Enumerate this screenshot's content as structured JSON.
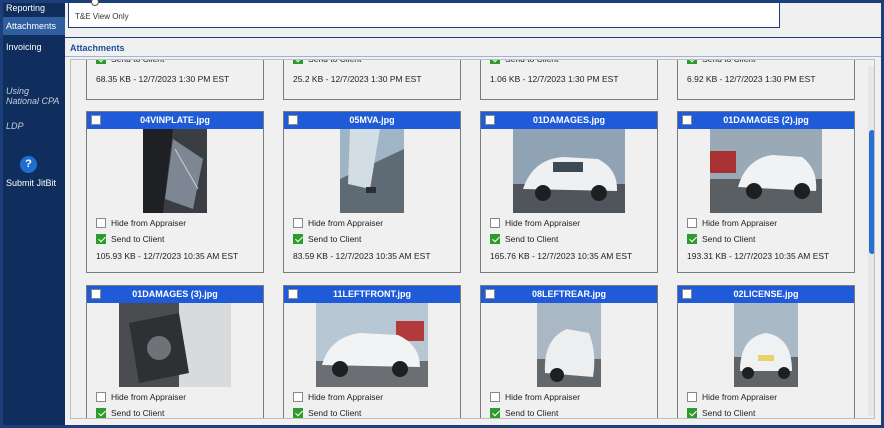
{
  "sidebar": {
    "items": [
      {
        "label": "Reporting"
      },
      {
        "label": "Attachments"
      },
      {
        "label": "Invoicing"
      },
      {
        "label": "Using National CPA"
      },
      {
        "label": "LDP"
      },
      {
        "label": "Submit JitBit"
      }
    ]
  },
  "top": {
    "note": "T&E View Only"
  },
  "section": {
    "title": "Attachments"
  },
  "options": {
    "hide": "Hide from Appraiser",
    "send": "Send to Client"
  },
  "partial_row": [
    {
      "meta": "68.35 KB - 12/7/2023 1:30 PM EST",
      "send_checked": true
    },
    {
      "meta": "25.2 KB - 12/7/2023 1:30 PM EST",
      "send_checked": true
    },
    {
      "meta": "1.06 KB - 12/7/2023 1:30 PM EST",
      "send_checked": true
    },
    {
      "meta": "6.92 KB - 12/7/2023 1:30 PM EST",
      "send_checked": true
    }
  ],
  "cards": [
    {
      "file": "04VINPLATE.jpg",
      "meta": "105.93 KB - 12/7/2023 10:35 AM EST",
      "hide_checked": false,
      "send_checked": true
    },
    {
      "file": "05MVA.jpg",
      "meta": "83.59 KB - 12/7/2023 10:35 AM EST",
      "hide_checked": false,
      "send_checked": true
    },
    {
      "file": "01DAMAGES.jpg",
      "meta": "165.76 KB - 12/7/2023 10:35 AM EST",
      "hide_checked": false,
      "send_checked": true
    },
    {
      "file": "01DAMAGES (2).jpg",
      "meta": "193.31 KB - 12/7/2023 10:35 AM EST",
      "hide_checked": false,
      "send_checked": true
    },
    {
      "file": "01DAMAGES (3).jpg",
      "hide_checked": false,
      "send_checked": true
    },
    {
      "file": "11LEFTFRONT.jpg",
      "hide_checked": false,
      "send_checked": true
    },
    {
      "file": "08LEFTREAR.jpg",
      "hide_checked": false,
      "send_checked": true
    },
    {
      "file": "02LICENSE.jpg",
      "hide_checked": false,
      "send_checked": true
    }
  ]
}
